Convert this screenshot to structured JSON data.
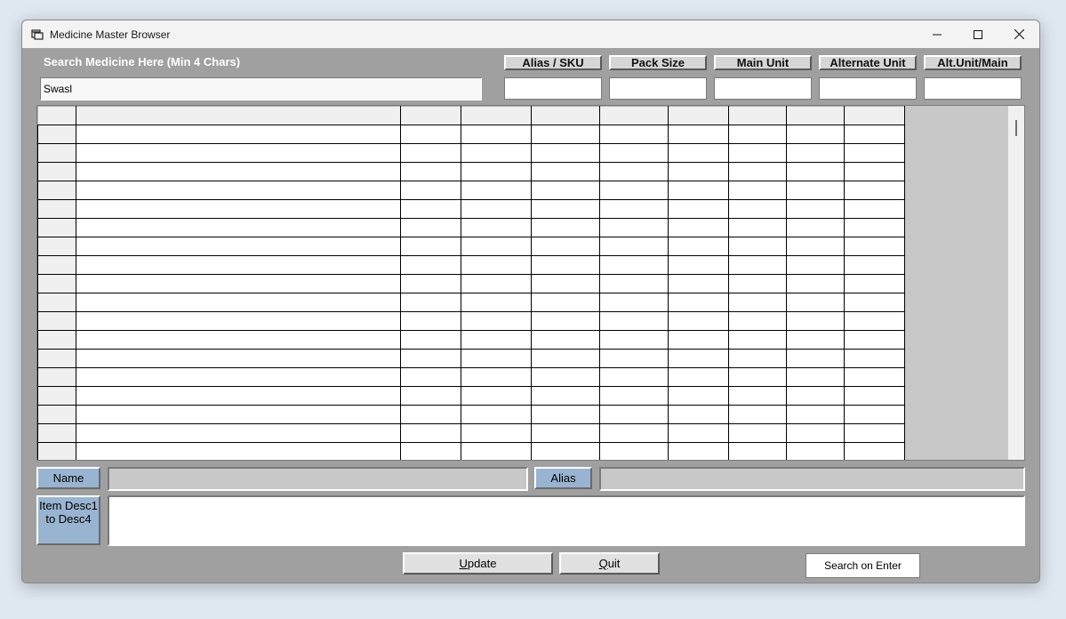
{
  "window": {
    "title": "Medicine Master Browser"
  },
  "search": {
    "label": "Search Medicine Here (Min 4 Chars)",
    "value": "Swasl"
  },
  "headers": {
    "alias_sku": "Alias / SKU",
    "pack_size": "Pack Size",
    "main_unit": "Main Unit",
    "alternate_unit": "Alternate Unit",
    "alt_unit_main": "Alt.Unit/Main"
  },
  "detail": {
    "name_label": "Name",
    "name_value": "",
    "alias_label": "Alias",
    "alias_value": "",
    "desc_label_line1": "Item Desc1",
    "desc_label_line2": "to Desc4",
    "desc_value": ""
  },
  "buttons": {
    "update_first": "U",
    "update_rest": "pdate",
    "quit_first": "Q",
    "quit_rest": "uit",
    "search_on_enter": "Search on Enter"
  }
}
